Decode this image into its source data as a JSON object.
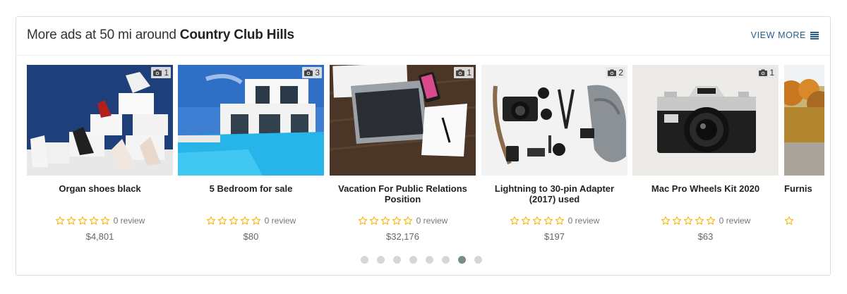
{
  "header": {
    "title_prefix": "More ads at 50 mi around ",
    "title_city": "Country Club Hills",
    "view_more_label": "VIEW MORE",
    "view_more_icon": "list-icon"
  },
  "colors": {
    "star": "#f5b301",
    "link": "#2b5d8a",
    "dot": "#d6d6d6",
    "dot_active": "#7a8b8b"
  },
  "cards": [
    {
      "title": "Organ shoes black",
      "photos": "1",
      "review_label": "0 review",
      "rating": 0,
      "price": "$4,801"
    },
    {
      "title": "5 Bedroom for sale",
      "photos": "3",
      "review_label": "0 review",
      "rating": 0,
      "price": "$80"
    },
    {
      "title": "Vacation For Public Relations Position",
      "photos": "1",
      "review_label": "0 review",
      "rating": 0,
      "price": "$32,176"
    },
    {
      "title": "Lightning to 30-pin Adapter (2017) used",
      "photos": "2",
      "review_label": "0 review",
      "rating": 0,
      "price": "$197"
    },
    {
      "title": "Mac Pro Wheels Kit 2020",
      "photos": "1",
      "review_label": "0 review",
      "rating": 0,
      "price": "$63"
    },
    {
      "title": "Furnis",
      "photos": "",
      "review_label": "",
      "rating": 0,
      "price": ""
    }
  ],
  "carousel": {
    "page_count": 8,
    "active_page": 7
  }
}
